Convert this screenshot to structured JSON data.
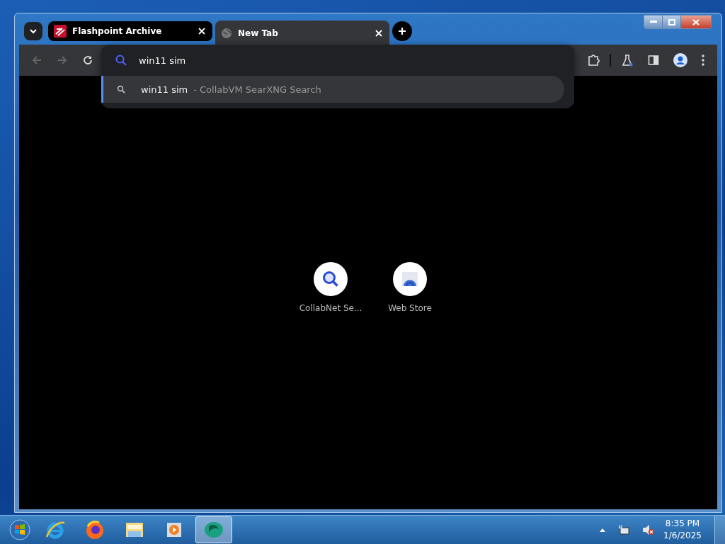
{
  "tabs": [
    {
      "title": "Flashpoint Archive",
      "kind": "flashpoint",
      "selected": false
    },
    {
      "title": "New Tab",
      "kind": "globe",
      "selected": true
    }
  ],
  "omnibox": {
    "value": "win11 sim",
    "suggestions": [
      {
        "query": "win11 sim",
        "source": "- CollabVM SearXNG Search",
        "selected": true
      }
    ]
  },
  "shortcuts": [
    {
      "label": "CollabNet Se...",
      "kind": "search"
    },
    {
      "label": "Web Store",
      "kind": "store"
    }
  ],
  "taskbar": {
    "apps": [
      {
        "kind": "ie",
        "active": false
      },
      {
        "kind": "firefox",
        "active": false
      },
      {
        "kind": "folder",
        "active": false
      },
      {
        "kind": "media",
        "active": false
      },
      {
        "kind": "vm",
        "active": true
      }
    ]
  },
  "clock": {
    "time": "8:35 PM",
    "date": "1/6/2025"
  }
}
